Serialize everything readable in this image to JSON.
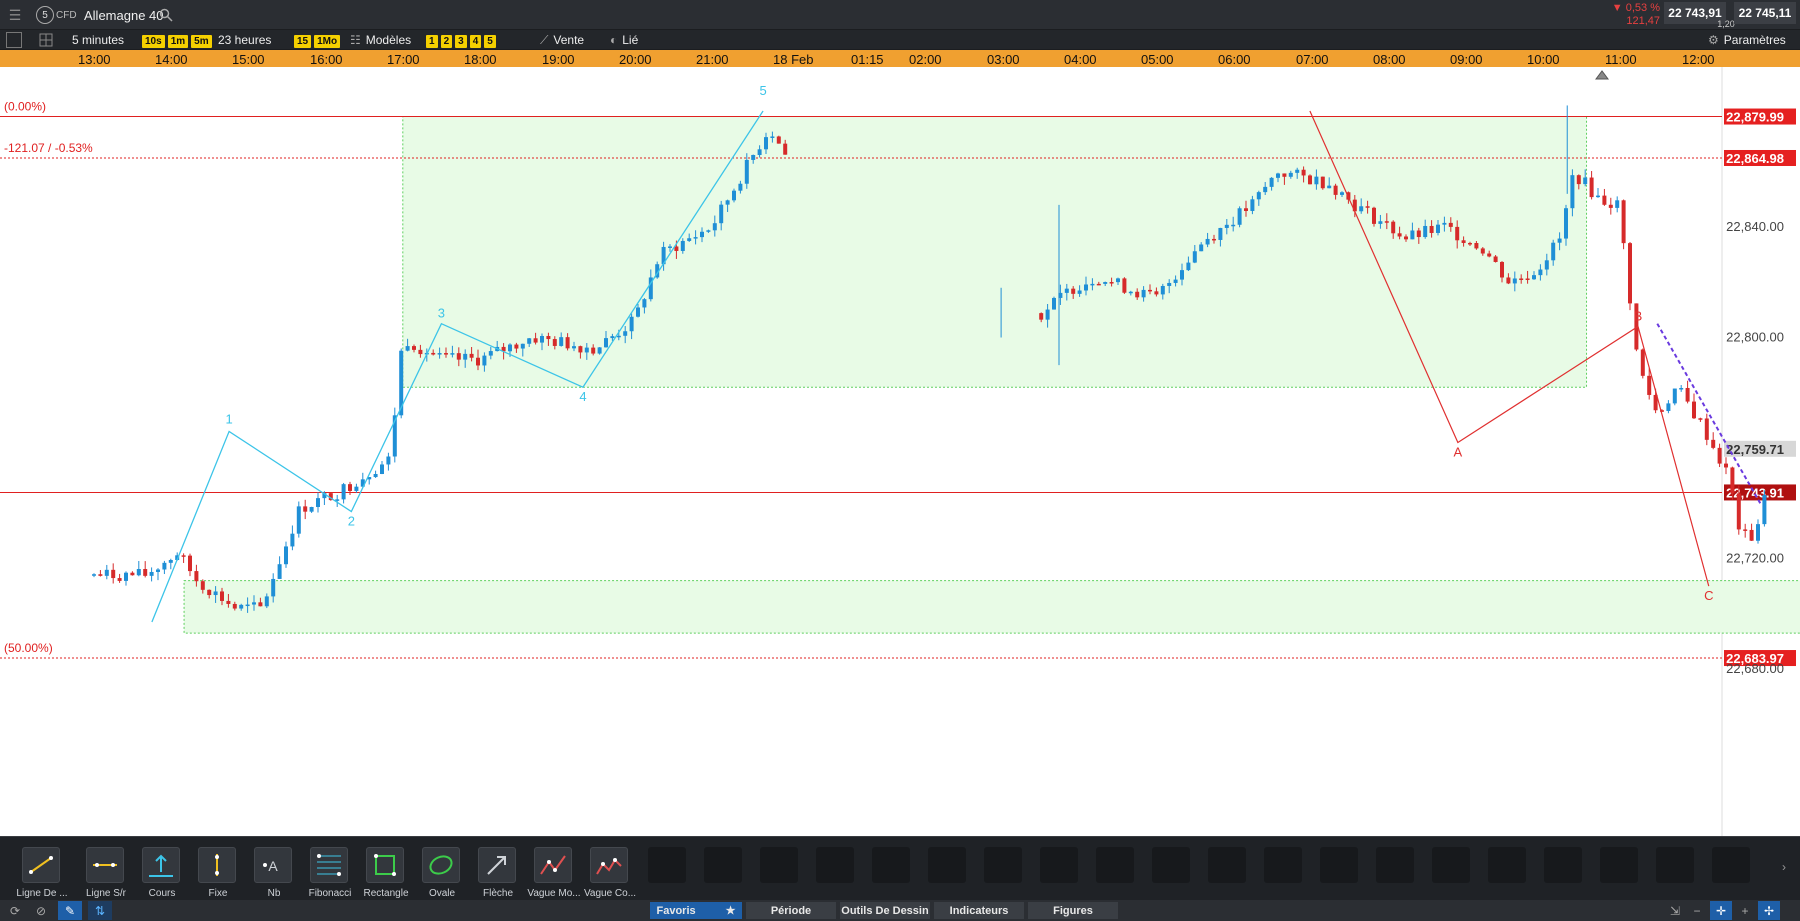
{
  "header": {
    "instrument_number": "5",
    "instrument_type": "CFD",
    "instrument_name": "Allemagne 40",
    "change_pct": "0,53 %",
    "change_abs": "121,47",
    "bid": "22 743,91",
    "spread": "1,20",
    "ask": "22 745,11"
  },
  "toolbar": {
    "timeframe": "5 minutes",
    "quick_intervals": [
      "10s",
      "1m",
      "5m"
    ],
    "range": "23 heures",
    "quick_ranges": [
      "15",
      "1Mo"
    ],
    "models_label": "Modèles",
    "presets": [
      "1",
      "2",
      "3",
      "4",
      "5"
    ],
    "sell_label": "Vente",
    "linked_label": "Lié",
    "settings_label": "Paramètres"
  },
  "time_axis": [
    "13:00",
    "14:00",
    "15:00",
    "16:00",
    "17:00",
    "18:00",
    "19:00",
    "20:00",
    "21:00",
    "18 Feb",
    "01:15",
    "02:00",
    "03:00",
    "04:00",
    "05:00",
    "06:00",
    "07:00",
    "08:00",
    "09:00",
    "10:00",
    "11:00",
    "12:00"
  ],
  "chart_data": {
    "type": "candlestick",
    "instrument": "Allemagne 40",
    "interval": "5 minutes",
    "ylim": [
      22665,
      22890
    ],
    "y_ticks": [
      22680,
      22720,
      22760,
      22800,
      22840
    ],
    "y_tick_labels": [
      "22,680.00",
      "22,720.00",
      "",
      "22,800.00",
      "22,840.00"
    ],
    "horizontal_levels": [
      {
        "label": "(0.00%)",
        "value": 22879.99,
        "value_label": "22,879.99",
        "style": "solid"
      },
      {
        "label": "-121.07 / -0.53%",
        "value": 22864.98,
        "value_label": "22,864.98",
        "style": "dotted"
      },
      {
        "label": "(50.00%)",
        "value": 22683.97,
        "value_label": "22,683.97",
        "style": "dotted"
      },
      {
        "label": "",
        "value": 22743.91,
        "value_label": "22,743.91",
        "style": "solid"
      }
    ],
    "grey_level": {
      "value": 22759.71,
      "value_label": "22,759.71"
    },
    "zones": [
      {
        "x_start": "17:00",
        "x_end": "08:20",
        "y_top": 22880,
        "y_bottom": 22782
      },
      {
        "x_start": "14:10",
        "x_end": "11:15",
        "y_top": 22712,
        "y_bottom": 22693
      }
    ],
    "wave_impulse": [
      {
        "label": "",
        "time": "13:45",
        "value": 22697
      },
      {
        "label": "1",
        "time": "14:45",
        "value": 22766
      },
      {
        "label": "2",
        "time": "16:20",
        "value": 22737
      },
      {
        "label": "3",
        "time": "17:30",
        "value": 22805
      },
      {
        "label": "4",
        "time": "19:20",
        "value": 22782
      },
      {
        "label": "5",
        "time": "21:40",
        "value": 22882
      }
    ],
    "wave_abc": [
      {
        "label": "",
        "time": "04:45",
        "value": 22882
      },
      {
        "label": "A",
        "time": "06:40",
        "value": 22762
      },
      {
        "label": "B",
        "time": "09:00",
        "value": 22804
      },
      {
        "label": "C",
        "time": "09:55",
        "value": 22710
      }
    ],
    "trendline": [
      {
        "time": "09:15",
        "value": 22805
      },
      {
        "time": "10:35",
        "value": 22740
      }
    ],
    "last_price": 22743.91
  },
  "draw_tools": [
    {
      "label": "Ligne De ..."
    },
    {
      "label": "Ligne S/r"
    },
    {
      "label": "Cours"
    },
    {
      "label": "Fixe"
    },
    {
      "label": "Nb"
    },
    {
      "label": "Fibonacci"
    },
    {
      "label": "Rectangle"
    },
    {
      "label": "Ovale"
    },
    {
      "label": "Flèche"
    },
    {
      "label": "Vague Mo..."
    },
    {
      "label": "Vague Co..."
    }
  ],
  "bottom_tabs": [
    "Favoris",
    "Période",
    "Outils De Dessin",
    "Indicateurs",
    "Figures"
  ],
  "colors": {
    "up": "#1f8fd6",
    "down": "#d62a2a",
    "wave": "#3cc4e8",
    "abc": "#e03030",
    "zone_fill": "#e8fbe6",
    "zone_border": "#5fcf5f",
    "time_axis": "#f0a030"
  }
}
